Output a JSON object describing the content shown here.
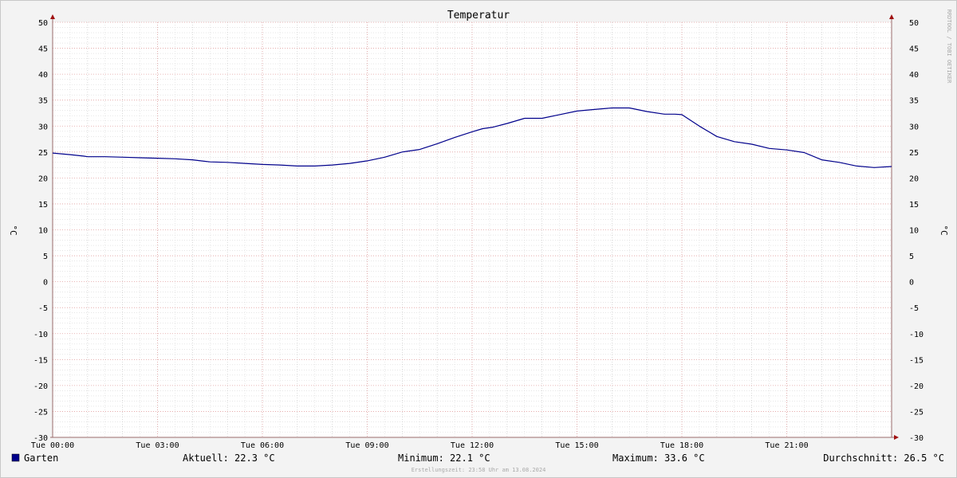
{
  "chart_data": {
    "type": "line",
    "title": "Temperatur",
    "ylabel": "°C",
    "ylabel_right": "°C",
    "ylim": [
      -30,
      50
    ],
    "y_ticks": [
      50,
      45,
      40,
      35,
      30,
      25,
      20,
      15,
      10,
      5,
      0,
      -5,
      -10,
      -15,
      -20,
      -25,
      -30
    ],
    "xlim": [
      0,
      24
    ],
    "x_ticks": [
      {
        "hour": 0,
        "label": "Tue 00:00"
      },
      {
        "hour": 3,
        "label": "Tue 03:00"
      },
      {
        "hour": 6,
        "label": "Tue 06:00"
      },
      {
        "hour": 9,
        "label": "Tue 09:00"
      },
      {
        "hour": 12,
        "label": "Tue 12:00"
      },
      {
        "hour": 15,
        "label": "Tue 15:00"
      },
      {
        "hour": 18,
        "label": "Tue 18:00"
      },
      {
        "hour": 21,
        "label": "Tue 21:00"
      }
    ],
    "grid": true,
    "legend_position": "bottom-left",
    "series": [
      {
        "name": "Garten",
        "color": "#00008b",
        "x": [
          0,
          0.5,
          0.9,
          1,
          1.5,
          2,
          2.5,
          3,
          3.5,
          4,
          4.5,
          5,
          5.5,
          6,
          6.5,
          7,
          7.5,
          8,
          8.5,
          9,
          9.5,
          10,
          10.5,
          11,
          11.5,
          12,
          12.3,
          12.6,
          13,
          13.5,
          14,
          14.5,
          15,
          15.5,
          16,
          16.5,
          17,
          17.5,
          17.8,
          18,
          18.5,
          19,
          19.5,
          20,
          20.5,
          21,
          21.5,
          22,
          22.5,
          23,
          23.5,
          24
        ],
        "values": [
          24.8,
          24.5,
          24.2,
          24.1,
          24.1,
          24.0,
          23.9,
          23.8,
          23.7,
          23.5,
          23.1,
          23.0,
          22.8,
          22.6,
          22.5,
          22.3,
          22.3,
          22.5,
          22.8,
          23.3,
          24.0,
          25.0,
          25.5,
          26.6,
          27.8,
          28.9,
          29.5,
          29.8,
          30.5,
          31.5,
          31.5,
          32.2,
          32.9,
          33.2,
          33.5,
          33.5,
          32.8,
          32.3,
          32.3,
          32.2,
          30.0,
          28.0,
          27.0,
          26.5,
          25.7,
          25.4,
          24.9,
          23.5,
          23.0,
          22.3,
          22.0,
          22.2
        ]
      }
    ],
    "stats": {
      "current": "Aktuell: 22.3 °C",
      "minimum": "Minimum: 22.1 °C",
      "maximum": "Maximum: 33.6 °C",
      "average": "Durchschnitt: 26.5 °C"
    },
    "created_at": "Erstellungszeit: 23:58 Uhr am 13.08.2024",
    "watermark": "RRDTOOL / TOBI OETIKER"
  }
}
